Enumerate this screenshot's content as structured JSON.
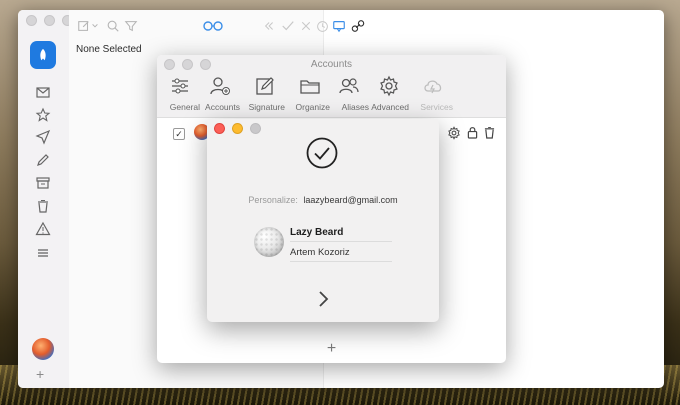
{
  "list": {
    "none_selected": "None Selected"
  },
  "accounts_dialog": {
    "title": "Accounts",
    "tabs": [
      {
        "label": "General",
        "icon": "sliders-icon"
      },
      {
        "label": "Accounts",
        "icon": "user-add-icon"
      },
      {
        "label": "Signature",
        "icon": "pencil-square-icon"
      },
      {
        "label": "Organize",
        "icon": "folder-icon"
      },
      {
        "label": "Aliases",
        "icon": "people-icon"
      },
      {
        "label": "Advanced",
        "icon": "gear-icon"
      },
      {
        "label": "Services",
        "icon": "cloud-bolt-icon"
      }
    ],
    "add_symbol": "+"
  },
  "setup_modal": {
    "personalize_label": "Personalize:",
    "email": "laazybeard@gmail.com",
    "display_name": "Lazy Beard",
    "full_name": "Artem Kozoriz"
  },
  "sidebar": {
    "add_symbol": "+"
  },
  "colors": {
    "accent": "#1f7ae0",
    "close": "#fc5f57",
    "minimize": "#fdbb2e"
  }
}
